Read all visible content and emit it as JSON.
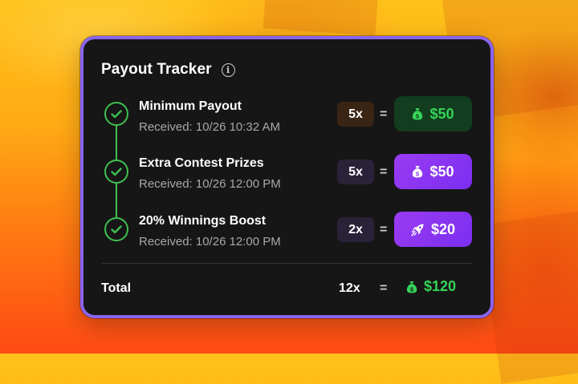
{
  "payout_tracker": {
    "title": "Payout Tracker",
    "info_icon": "info-circle-icon",
    "items": [
      {
        "title": "Minimum Payout",
        "received": "Received: 10/26 10:32 AM",
        "multiplier": "5x",
        "equals": "=",
        "amount": "$50",
        "amount_icon": "money-bag-icon",
        "style": "green"
      },
      {
        "title": "Extra Contest Prizes",
        "received": "Received: 10/26 12:00 PM",
        "multiplier": "5x",
        "equals": "=",
        "amount": "$50",
        "amount_icon": "money-bag-icon",
        "style": "purple"
      },
      {
        "title": "20% Winnings Boost",
        "received": "Received: 10/26 12:00 PM",
        "multiplier": "2x",
        "equals": "=",
        "amount": "$20",
        "amount_icon": "rocket-icon",
        "style": "purple"
      }
    ],
    "total": {
      "label": "Total",
      "multiplier": "12x",
      "equals": "=",
      "amount": "$120",
      "amount_icon": "money-bag-icon"
    }
  },
  "colors": {
    "card_background": "#161616",
    "card_border": "#8a63ee",
    "check_green": "#3fbf4f",
    "money_green": "#35d457",
    "purple_accent": "#8a3cf2",
    "background_orange": "#ff7a12",
    "background_yellow": "#ffc21a"
  }
}
